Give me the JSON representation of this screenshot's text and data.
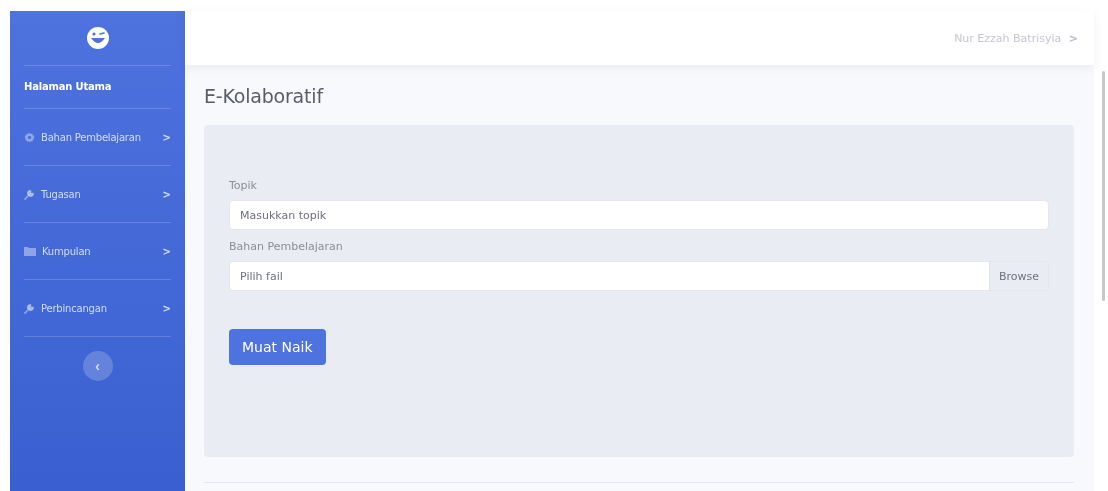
{
  "sidebar": {
    "home_link": "Halaman Utama",
    "items": [
      {
        "label": "Bahan Pembelajaran",
        "chevron": ">"
      },
      {
        "label": "Tugasan",
        "chevron": ">"
      },
      {
        "label": "Kumpulan",
        "chevron": ">"
      },
      {
        "label": "Perbincangan",
        "chevron": ">"
      }
    ],
    "collapse_button": "‹"
  },
  "topbar": {
    "user_name": "Nur Ezzah Batrisyia",
    "user_chevron": ">"
  },
  "page_title": "E-Kolaboratif",
  "form": {
    "topic_label": "Topik",
    "topic_placeholder": "Masukkan topik",
    "file_label": "Bahan Pembelajaran",
    "file_placeholder": "Pilih fail",
    "browse_button": "Browse",
    "submit_button": "Muat Naik"
  }
}
